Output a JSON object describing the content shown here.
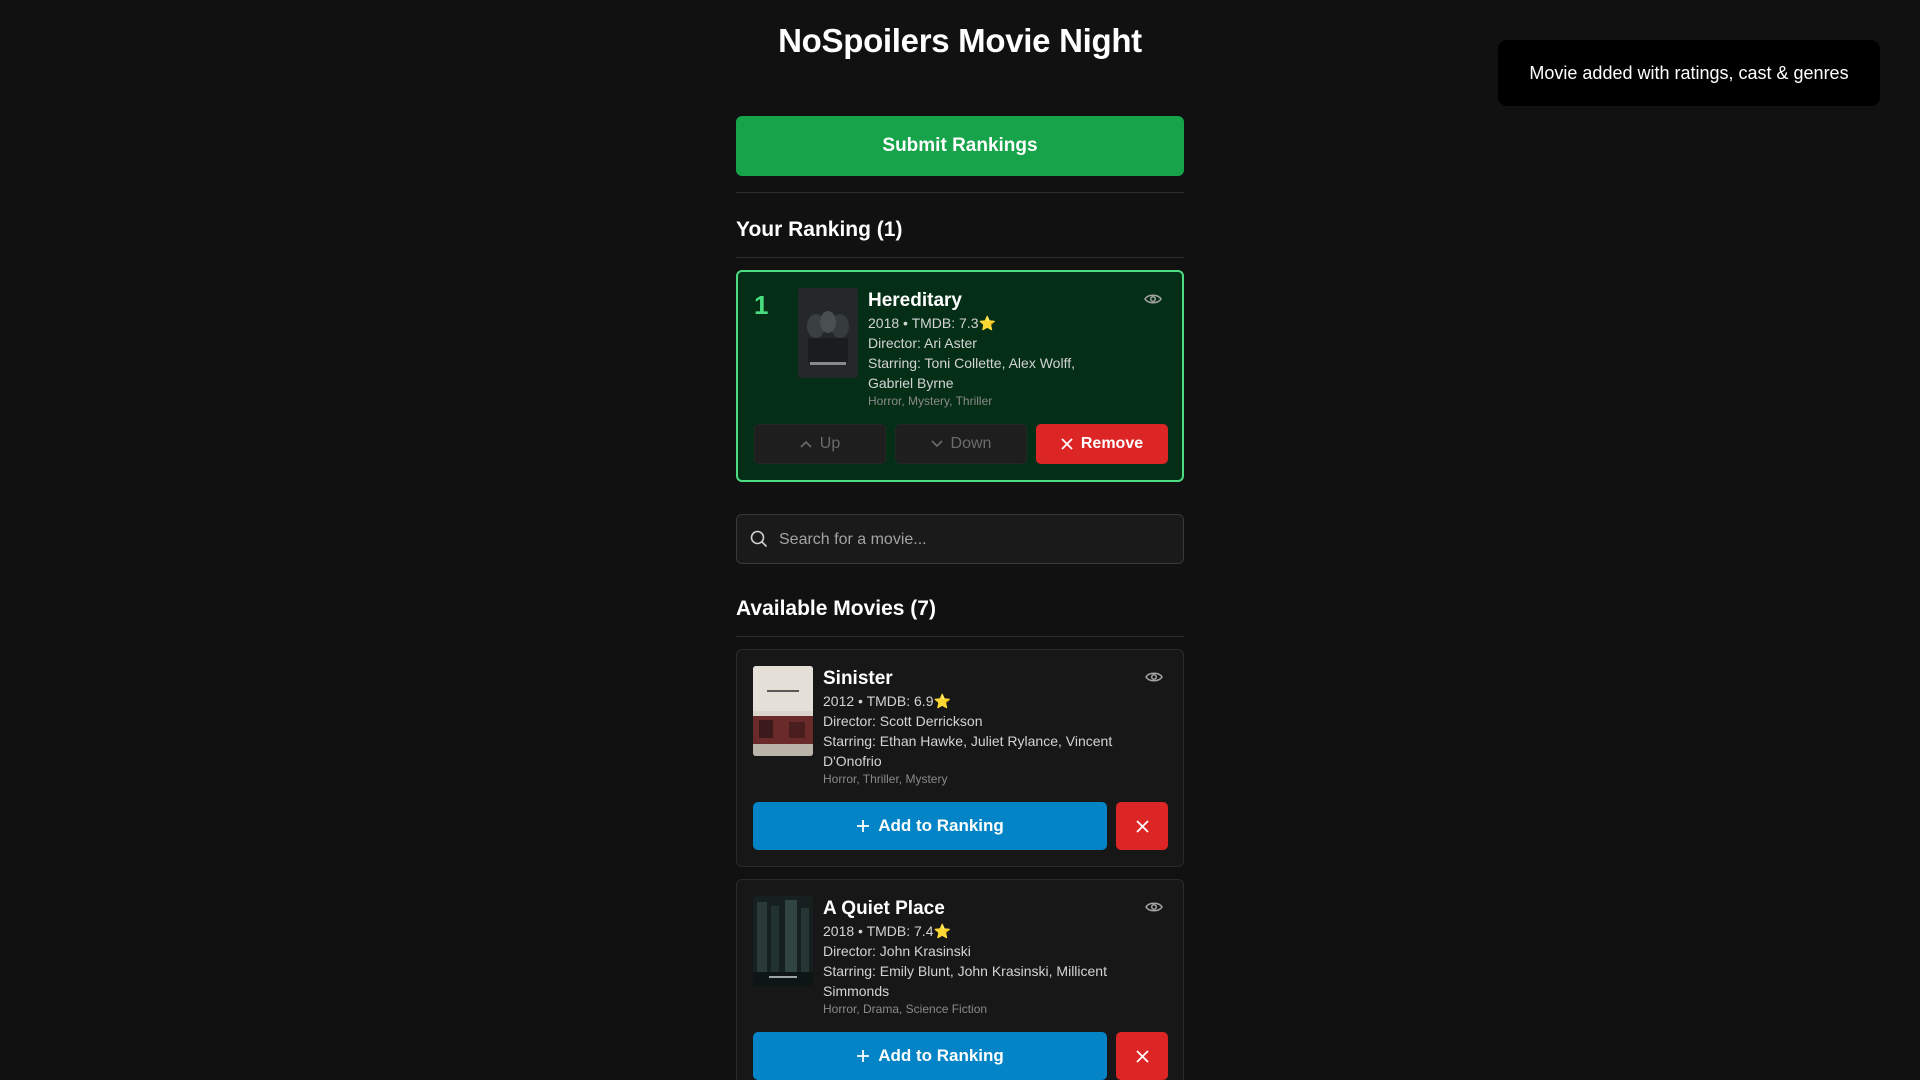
{
  "app": {
    "title": "NoSpoilers Movie Night"
  },
  "toast": {
    "message": "Movie added with ratings, cast & genres"
  },
  "actions": {
    "submit_label": "Submit Rankings"
  },
  "ranking": {
    "heading": "Your Ranking (1)",
    "items": [
      {
        "rank": "1",
        "title": "Hereditary",
        "meta": "2018 • TMDB: 7.3",
        "star": "⭐",
        "director": "Director: Ari Aster",
        "starring_line1": "Starring: Toni Collette, Alex Wolff,",
        "starring_line2": "Gabriel Byrne",
        "genres": "Horror, Mystery, Thriller",
        "up_label": "Up",
        "down_label": "Down",
        "remove_label": "Remove"
      }
    ]
  },
  "search": {
    "placeholder": "Search for a movie..."
  },
  "available": {
    "heading": "Available Movies (7)",
    "add_label": "Add to Ranking",
    "items": [
      {
        "title": "Sinister",
        "meta": "2012 • TMDB: 6.9",
        "star": "⭐",
        "director": "Director: Scott Derrickson",
        "starring_line1": "Starring: Ethan Hawke, Juliet Rylance, Vincent",
        "starring_line2": "D'Onofrio",
        "genres": "Horror, Thriller, Mystery"
      },
      {
        "title": "A Quiet Place",
        "meta": "2018 • TMDB: 7.4",
        "star": "⭐",
        "director": "Director: John Krasinski",
        "starring_line1": "Starring: Emily Blunt, John Krasinski, Millicent",
        "starring_line2": "Simmonds",
        "genres": "Horror, Drama, Science Fiction"
      }
    ]
  },
  "colors": {
    "background": "#111111",
    "submit": "#16a34a",
    "ranked_card_bg": "#052e16",
    "ranked_accent": "#4ade80",
    "add_button": "#0284c7",
    "danger": "#dc2626",
    "star": "#facc15"
  }
}
